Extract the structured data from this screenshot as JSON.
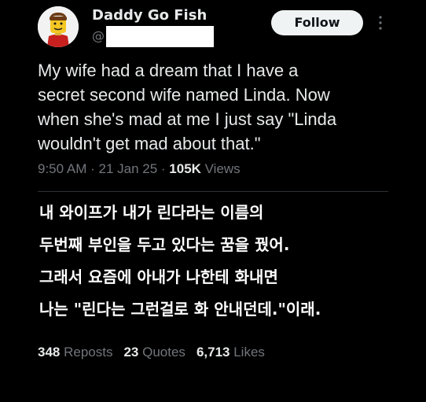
{
  "author": {
    "display_name": "Daddy Go Fish",
    "handle_prefix": "@",
    "avatar_icon": "lego-minifigure-avatar"
  },
  "header": {
    "follow_label": "Follow",
    "more_icon": "more-dots-icon"
  },
  "tweet": {
    "text": "My wife had a dream that I have a\nsecret second wife named Linda. Now\nwhen she's mad at me I just say \"Linda\nwouldn't get mad about that.\""
  },
  "meta": {
    "time": "9:50 AM",
    "sep1": " · ",
    "date": "21 Jan 25",
    "sep2": " · ",
    "views_count": "105K",
    "views_label": " Views"
  },
  "translation": {
    "lines": [
      "내 와이프가 내가 린다라는 이름의",
      "두번째 부인을 두고 있다는 꿈을 꿨어.",
      "그래서 요즘에 아내가 나한테 화내면",
      "나는 \"린다는 그런걸로 화 안내던데.\"이래."
    ]
  },
  "stats": {
    "reposts_count": "348",
    "reposts_label": " Reposts",
    "quotes_count": "23",
    "quotes_label": " Quotes",
    "likes_count": "6,713",
    "likes_label": " Likes"
  },
  "colors": {
    "background": "#000000",
    "primary_text": "#e7e9ea",
    "secondary_text": "#71767b",
    "follow_bg": "#eff3f4",
    "divider": "#2f3336"
  }
}
